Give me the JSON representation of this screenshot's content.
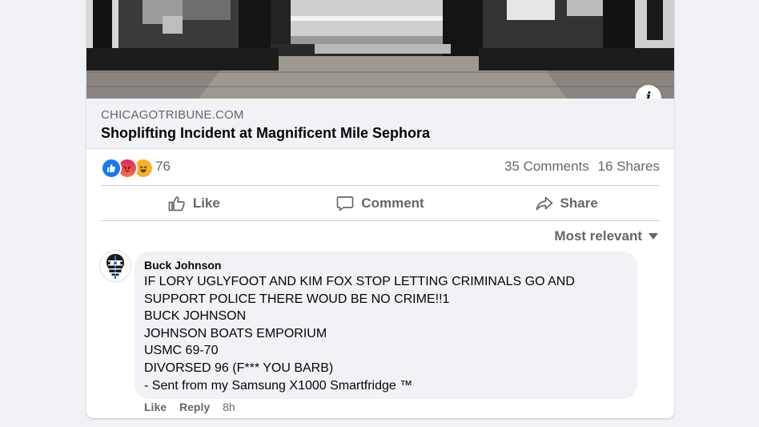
{
  "link": {
    "domain": "CHICAGOTRIBUNE.COM",
    "title": "Shoplifting Incident at Magnificent Mile Sephora"
  },
  "stats": {
    "reaction_icons": [
      "like-icon",
      "angry-icon",
      "haha-icon"
    ],
    "reaction_count": "76",
    "comments": "35 Comments",
    "shares": "16 Shares"
  },
  "actions": {
    "like": "Like",
    "comment": "Comment",
    "share": "Share"
  },
  "sort": {
    "label": "Most relevant"
  },
  "comment": {
    "author": "Buck Johnson",
    "lines": [
      "IF LORY UGLYFOOT AND KIM FOX STOP LETTING CRIMINALS GO AND",
      "SUPPORT POLICE THERE WOUD BE NO CRIME!!1",
      "BUCK JOHNSON",
      "JOHNSON BOATS EMPORIUM",
      "USMC 69-70",
      "DIVORSED 96 (F*** YOU BARB)",
      "- Sent from my Samsung X1000 Smartfridge ™"
    ],
    "like": "Like",
    "reply": "Reply",
    "time": "8h"
  },
  "colors": {
    "like_blue": "#1877f2",
    "secondary_text": "#65676b",
    "bubble_bg": "#f0f2f5"
  }
}
